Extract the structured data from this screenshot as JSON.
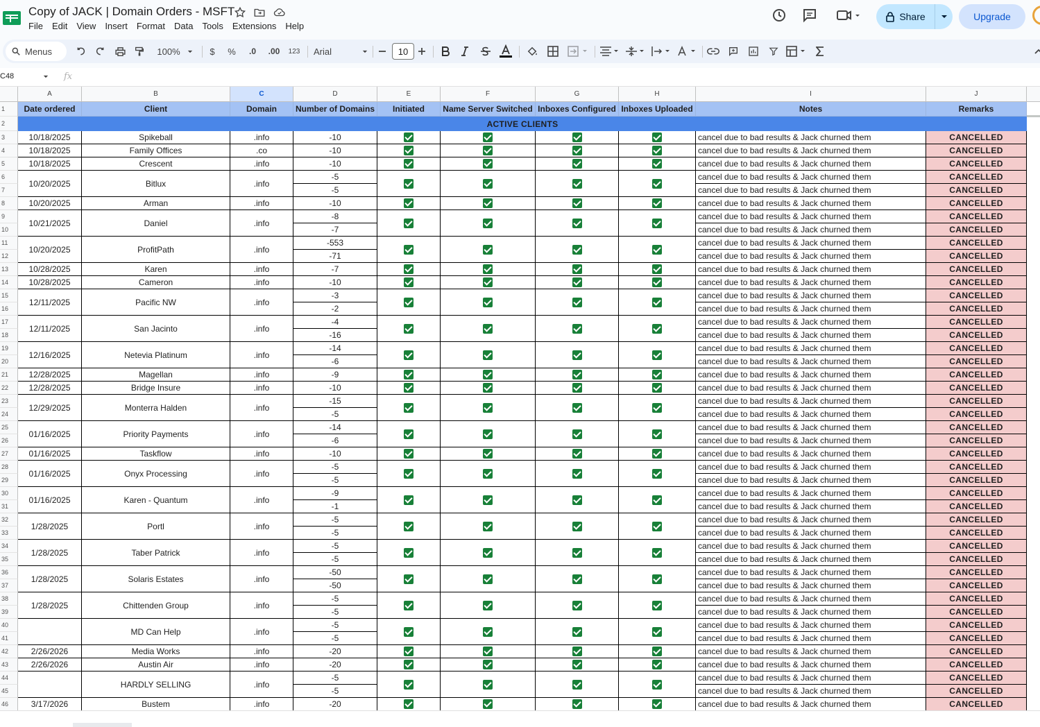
{
  "window": {
    "doc_title": "Copy of JACK | Domain Orders - MSFT",
    "menus": [
      "File",
      "Edit",
      "View",
      "Insert",
      "Format",
      "Data",
      "Tools",
      "Extensions",
      "Help"
    ],
    "share_label": "Share",
    "upgrade_label": "Upgrade"
  },
  "toolbar": {
    "menus_label": "Menus",
    "zoom": "100%",
    "currency": "$",
    "percent": "%",
    "dec_decrease": ".0",
    "dec_increase": ".00",
    "number_format": "123",
    "font": "Arial",
    "font_size": "10"
  },
  "formula_bar": {
    "cell_ref": "C48",
    "fx": "fx"
  },
  "columns": [
    "A",
    "B",
    "C",
    "D",
    "E",
    "F",
    "G",
    "H",
    "I",
    "J"
  ],
  "selected_column": "C",
  "header_row": [
    "Date ordered",
    "Client",
    "Domain",
    "Number of Domains",
    "Initiated",
    "Name Server Switched",
    "Inboxes Configured",
    "Inboxes Uploaded",
    "Notes",
    "Remarks"
  ],
  "section_label": "ACTIVE CLIENTS",
  "row_numbers": [
    "1",
    "2",
    "3",
    "4",
    "5",
    "6",
    "7",
    "8",
    "9",
    "10",
    "11",
    "12",
    "13",
    "14",
    "15",
    "16",
    "17",
    "18",
    "19",
    "20",
    "21",
    "22",
    "23",
    "24",
    "25",
    "26",
    "27",
    "28",
    "29",
    "30",
    "31",
    "32",
    "33",
    "34",
    "35",
    "36",
    "37",
    "38",
    "39",
    "40",
    "41",
    "42",
    "43",
    "44",
    "45",
    "46"
  ],
  "note_text": "cancel due to bad results & Jack churned them",
  "remark_text": "CANCELLED",
  "orders": [
    {
      "date": "10/18/2025",
      "client": "Spikeball",
      "domain": ".info",
      "counts": [
        "-10"
      ]
    },
    {
      "date": "10/18/2025",
      "client": "Family Offices",
      "domain": ".co",
      "counts": [
        "-10"
      ]
    },
    {
      "date": "10/18/2025",
      "client": "Crescent",
      "domain": ".info",
      "counts": [
        "-10"
      ]
    },
    {
      "date": "10/20/2025",
      "client": "Bitlux",
      "domain": ".info",
      "counts": [
        "-5",
        "-5"
      ]
    },
    {
      "date": "10/20/2025",
      "client": "Arman",
      "domain": ".info",
      "counts": [
        "-10"
      ]
    },
    {
      "date": "10/21/2025",
      "client": "Daniel",
      "domain": ".info",
      "counts": [
        "-8",
        "-7"
      ]
    },
    {
      "date": "10/20/2025",
      "client": "ProfitPath",
      "domain": ".info",
      "counts": [
        "-553",
        "-71"
      ]
    },
    {
      "date": "10/28/2025",
      "client": "Karen",
      "domain": ".info",
      "counts": [
        "-7"
      ]
    },
    {
      "date": "10/28/2025",
      "client": "Cameron",
      "domain": ".info",
      "counts": [
        "-10"
      ]
    },
    {
      "date": "12/11/2025",
      "client": "Pacific NW",
      "domain": ".info",
      "counts": [
        "-3",
        "-2"
      ]
    },
    {
      "date": "12/11/2025",
      "client": "San Jacinto",
      "domain": ".info",
      "counts": [
        "-4",
        "-16"
      ]
    },
    {
      "date": "12/16/2025",
      "client": "Netevia Platinum",
      "domain": ".info",
      "counts": [
        "-14",
        "-6"
      ]
    },
    {
      "date": "12/28/2025",
      "client": "Magellan",
      "domain": ".info",
      "counts": [
        "-9"
      ]
    },
    {
      "date": "12/28/2025",
      "client": "Bridge Insure",
      "domain": ".info",
      "counts": [
        "-10"
      ]
    },
    {
      "date": "12/29/2025",
      "client": "Monterra Halden",
      "domain": ".info",
      "counts": [
        "-15",
        "-5"
      ]
    },
    {
      "date": "01/16/2025",
      "client": "Priority Payments",
      "domain": ".info",
      "counts": [
        "-14",
        "-6"
      ]
    },
    {
      "date": "01/16/2025",
      "client": "Taskflow",
      "domain": ".info",
      "counts": [
        "-10"
      ]
    },
    {
      "date": "01/16/2025",
      "client": "Onyx Processing",
      "domain": ".info",
      "counts": [
        "-5",
        "-5"
      ]
    },
    {
      "date": "01/16/2025",
      "client": "Karen - Quantum",
      "domain": ".info",
      "counts": [
        "-9",
        "-1"
      ]
    },
    {
      "date": "1/28/2025",
      "client": "Portl",
      "domain": ".info",
      "counts": [
        "-5",
        "-5"
      ]
    },
    {
      "date": "1/28/2025",
      "client": "Taber Patrick",
      "domain": ".info",
      "counts": [
        "-5",
        "-5"
      ]
    },
    {
      "date": "1/28/2025",
      "client": "Solaris Estates",
      "domain": ".info",
      "counts": [
        "-50",
        "-50"
      ]
    },
    {
      "date": "1/28/2025",
      "client": "Chittenden Group",
      "domain": ".info",
      "counts": [
        "-5",
        "-5"
      ]
    },
    {
      "date": "",
      "client": "MD Can Help",
      "domain": ".info",
      "counts": [
        "-5",
        "-5"
      ]
    },
    {
      "date": "2/26/2026",
      "client": "Media Works",
      "domain": ".info",
      "counts": [
        "-20"
      ]
    },
    {
      "date": "2/26/2026",
      "client": "Austin Air",
      "domain": ".info",
      "counts": [
        "-20"
      ]
    },
    {
      "date": "",
      "client": "HARDLY SELLING",
      "domain": ".info",
      "counts": [
        "-5",
        "-5"
      ]
    },
    {
      "date": "3/17/2026",
      "client": "Bustem",
      "domain": ".info",
      "counts": [
        "-20"
      ]
    }
  ],
  "colors": {
    "header_fill": "#a4c2f4",
    "section_fill": "#4a86e8",
    "remark_fill": "#f4cccc",
    "checkbox": "#188038",
    "share_fill": "#c2e7ff",
    "upgrade_fill": "#d3e3fd"
  }
}
